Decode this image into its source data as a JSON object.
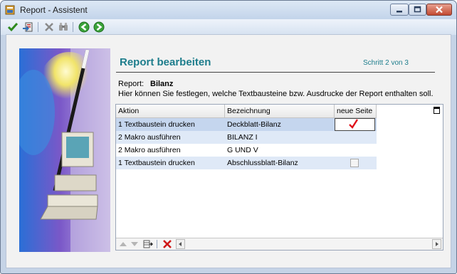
{
  "window": {
    "title": "Report - Assistent"
  },
  "toolbar": {
    "buttons": [
      {
        "icon": "check-icon",
        "label": "OK"
      },
      {
        "icon": "export-icon",
        "label": "Export"
      },
      {
        "icon": "cancel-x-icon",
        "label": "Abbrechen"
      },
      {
        "icon": "binoculars-icon",
        "label": "Suchen"
      },
      {
        "icon": "back-arrow-icon",
        "label": "Zurück"
      },
      {
        "icon": "forward-arrow-icon",
        "label": "Weiter"
      }
    ]
  },
  "page": {
    "heading": "Report bearbeiten",
    "step": "Schritt 2 von 3",
    "report_label": "Report:",
    "report_value": "Bilanz",
    "description": "Hier können Sie festlegen, welche Textbausteine bzw. Ausdrucke der Report enthalten soll."
  },
  "grid": {
    "columns": [
      "Aktion",
      "Bezeichnung",
      "neue Seite"
    ],
    "rows": [
      {
        "aktion": "1  Textbaustein drucken",
        "bezeichnung": "Deckblatt-Bilanz",
        "neue_seite": "checked"
      },
      {
        "aktion": "2  Makro ausführen",
        "bezeichnung": "BILANZ I",
        "neue_seite": ""
      },
      {
        "aktion": "2  Makro ausführen",
        "bezeichnung": "G UND V",
        "neue_seite": ""
      },
      {
        "aktion": "1  Textbaustein drucken",
        "bezeichnung": "Abschlussblatt-Bilanz",
        "neue_seite": "unchecked"
      }
    ]
  },
  "colors": {
    "accent": "#1d7d8c",
    "selected_row": "#c5d6ee",
    "alt_row": "#dfe9f7",
    "check": "#e0101a"
  }
}
